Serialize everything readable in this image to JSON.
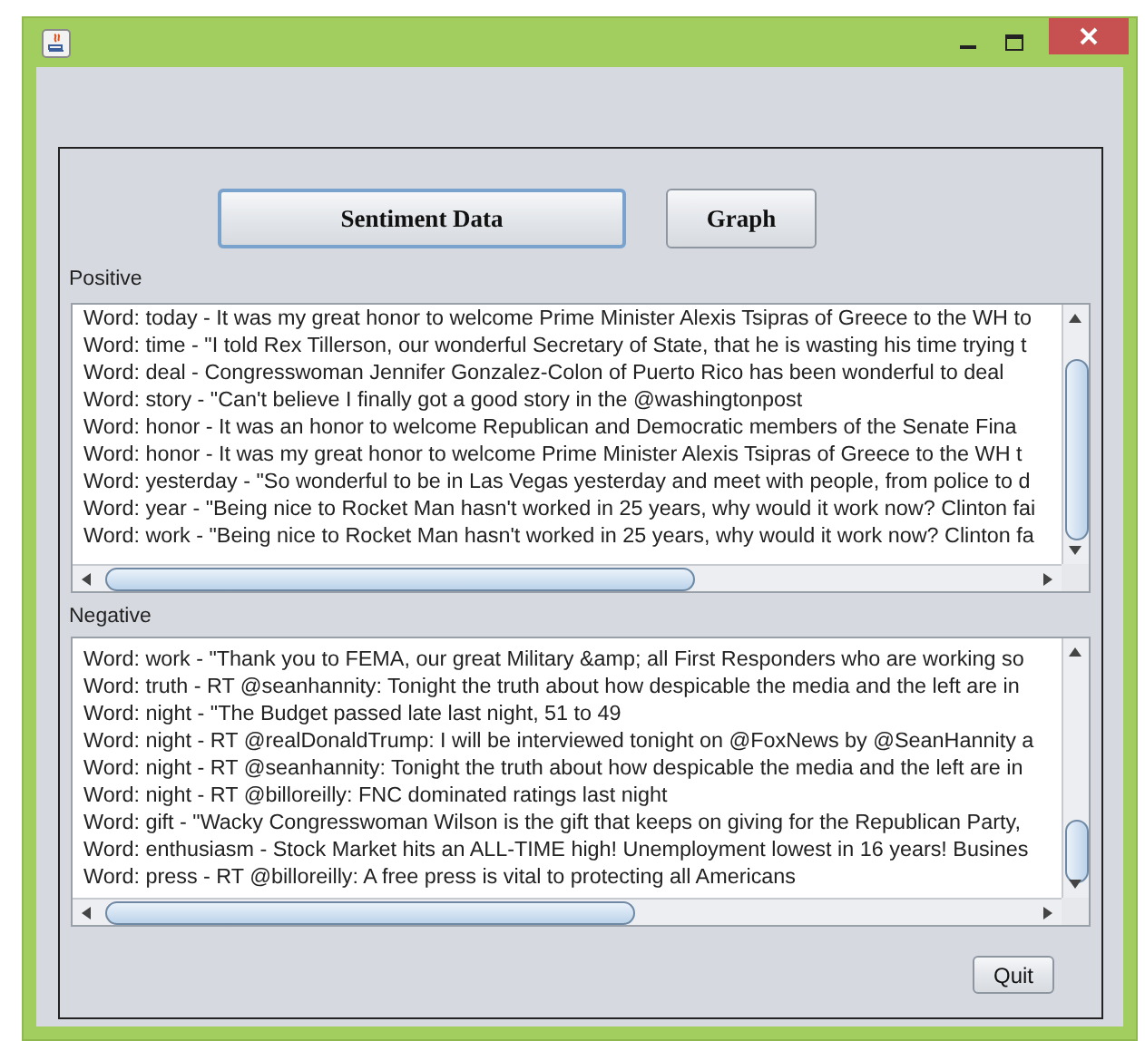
{
  "buttons": [
    {
      "label": "Sentiment Data",
      "focused": true
    },
    {
      "label": "Graph",
      "focused": false
    }
  ],
  "positive": {
    "label": "Positive",
    "lines": [
      "Word: today - It was my great honor to welcome Prime Minister Alexis Tsipras of Greece to the WH to",
      "Word: time - \"I told Rex Tillerson, our wonderful Secretary of State, that he is wasting his time trying t",
      "Word: deal - Congresswoman Jennifer Gonzalez-Colon of Puerto Rico has been wonderful to deal",
      "Word: story - \"Can't believe I finally got a good story in the @washingtonpost",
      "Word: honor - It was an honor to welcome Republican and Democratic members of the Senate Fina",
      "Word: honor - It was my great honor to welcome Prime Minister Alexis Tsipras of Greece to the WH t",
      "Word: yesterday - \"So wonderful to be in Las Vegas yesterday and meet with people, from police to d",
      "Word: year - \"Being nice to Rocket Man hasn't worked in 25 years, why would it work now? Clinton fai",
      "Word: work - \"Being nice to Rocket Man hasn't worked in 25 years, why would it work now? Clinton fa"
    ]
  },
  "negative": {
    "label": "Negative",
    "lines": [
      "Word: work - \"Thank you to FEMA, our great Military &amp; all First Responders who are working so",
      "Word: truth - RT @seanhannity: Tonight the truth about how despicable the media and the left are in",
      "Word: night - \"The Budget passed late last night, 51 to 49",
      "Word: night - RT @realDonaldTrump: I will be interviewed tonight on @FoxNews by @SeanHannity a",
      "Word: night - RT @seanhannity: Tonight the truth about how despicable the media and the left are in",
      "Word: night - RT @billoreilly: FNC dominated ratings last night",
      "Word: gift - \"Wacky Congresswoman Wilson is the gift that keeps on giving for the Republican Party,",
      "Word: enthusiasm - Stock Market hits an ALL-TIME high! Unemployment lowest in 16 years! Busines",
      "Word: press - RT @billoreilly: A free press is vital to protecting all Americans"
    ]
  },
  "quit_button": {
    "label": "Quit"
  }
}
